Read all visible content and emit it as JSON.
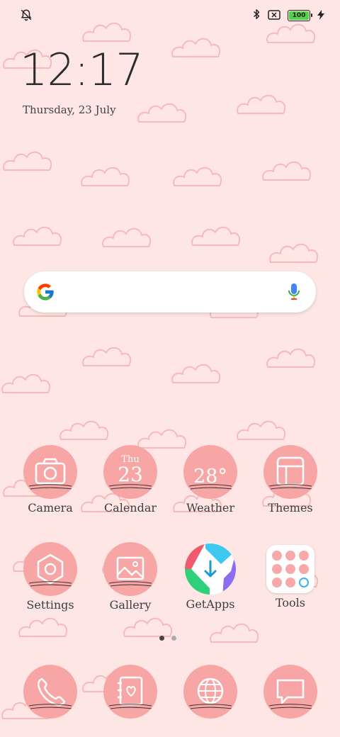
{
  "status_bar": {
    "left_icon": "notifications-off-icon",
    "right_icons": [
      "bluetooth-icon",
      "no-sim-icon",
      "battery-icon",
      "charging-icon"
    ],
    "battery_level": "100"
  },
  "lockscreen": {
    "time": "12:17",
    "date": "Thursday, 23 July"
  },
  "search": {
    "left_icon": "google-logo-icon",
    "right_icon": "microphone-icon"
  },
  "apps_row1": [
    {
      "label": "Camera",
      "icon": "camera-icon"
    },
    {
      "label": "Calendar",
      "icon": "calendar-icon",
      "day": "Thu",
      "date": "23"
    },
    {
      "label": "Weather",
      "icon": "weather-icon",
      "temperature": "28°"
    },
    {
      "label": "Themes",
      "icon": "themes-icon"
    }
  ],
  "apps_row2": [
    {
      "label": "Settings",
      "icon": "settings-icon"
    },
    {
      "label": "Gallery",
      "icon": "gallery-icon"
    },
    {
      "label": "GetApps",
      "icon": "getapps-icon"
    },
    {
      "label": "Tools",
      "icon": "tools-folder-icon"
    }
  ],
  "pager": {
    "pages": 2,
    "current": 1
  },
  "dock": [
    {
      "icon": "phone-icon"
    },
    {
      "icon": "contacts-icon"
    },
    {
      "icon": "browser-icon"
    },
    {
      "icon": "messages-icon"
    }
  ],
  "colors": {
    "wallpaper": "#fde6e4",
    "cloud_outline": "#f6b9bc",
    "icon_background": "#f8a5a5",
    "battery_fill": "#54d14a"
  }
}
